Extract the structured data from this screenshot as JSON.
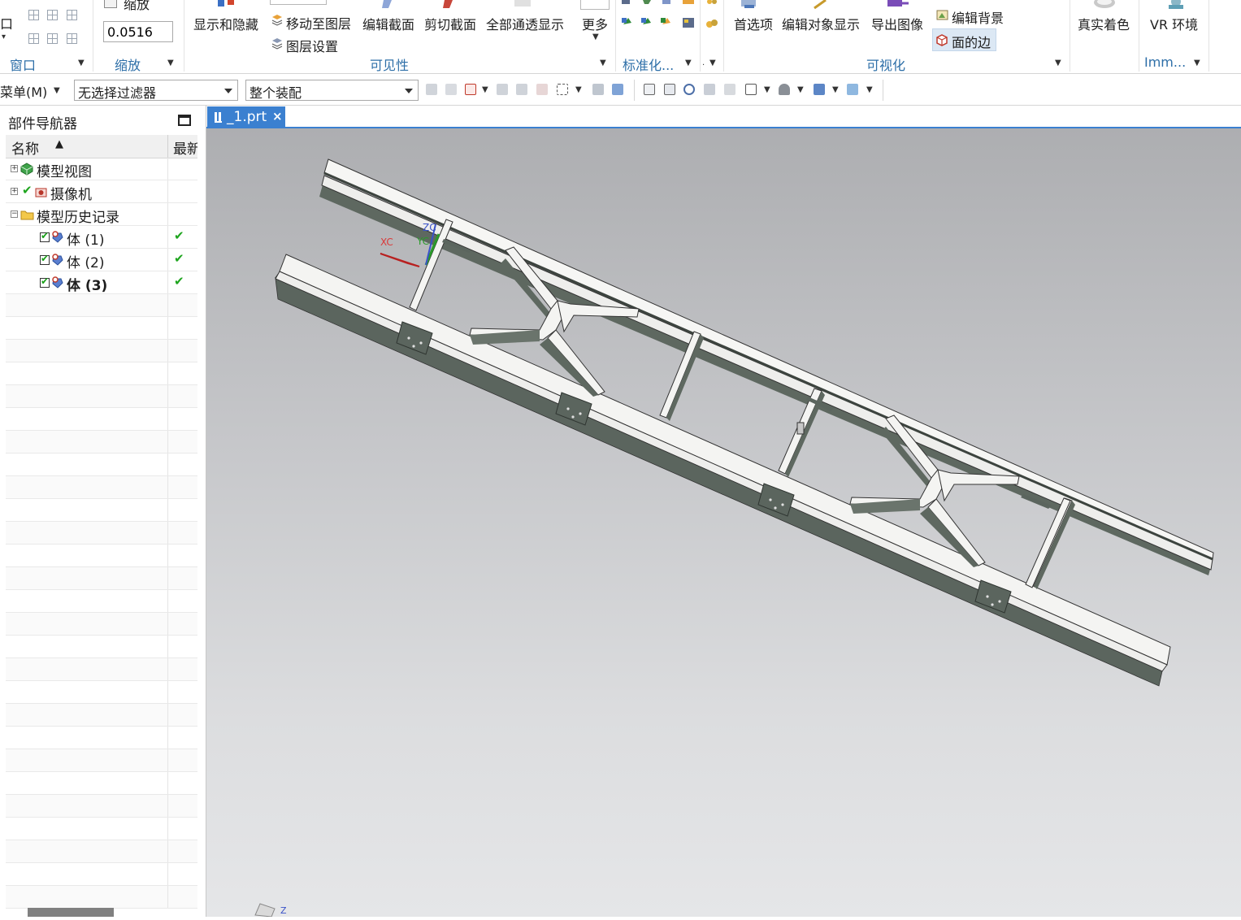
{
  "ribbon": {
    "window_group": {
      "top_label": "口",
      "group_label": "窗口"
    },
    "zoom_group": {
      "top_label": "缩放",
      "zoom_value": "0.0516",
      "group_label": "缩放"
    },
    "visibility_group": {
      "show_hide": "显示和隐藏",
      "move_to_layer": "移动至图层",
      "layer_settings": "图层设置",
      "edit_section": "编辑截面",
      "clip_section": "剪切截面",
      "all_transparent": "全部通透显示",
      "more": "更多",
      "group_label": "可见性"
    },
    "standardize_group": {
      "group_label": "标准化..."
    },
    "visualization_group": {
      "preferences": "首选项",
      "edit_object_display": "编辑对象显示",
      "export_image": "导出图像",
      "edit_background": "编辑背景",
      "face_edges": "面的边",
      "group_label": "可视化"
    },
    "true_shading": "真实着色",
    "vr_env": "VR 环境",
    "immersive_label": "Imm..."
  },
  "toolbar2": {
    "menu_label": "菜单(M)",
    "filter_value": "无选择过滤器",
    "assembly_value": "整个装配"
  },
  "navigator": {
    "title": "部件导航器",
    "col_name": "名称",
    "col_latest": "最新",
    "rows": [
      {
        "label": "模型视图"
      },
      {
        "label": "摄像机"
      },
      {
        "label": "模型历史记录"
      },
      {
        "label": "体 (1)"
      },
      {
        "label": "体 (2)"
      },
      {
        "label": "体 (3)"
      }
    ]
  },
  "tab": {
    "title": "_1.prt",
    "close": "×"
  },
  "viewport": {
    "triad": {
      "xc": "XC",
      "yc": "YC",
      "zc": "ZC"
    },
    "corner_z": "Z"
  },
  "colors": {
    "accent": "#3b80d0",
    "group_label": "#2e6fa8",
    "frame_face": "#f4f4f2",
    "frame_side": "#5e6860"
  }
}
